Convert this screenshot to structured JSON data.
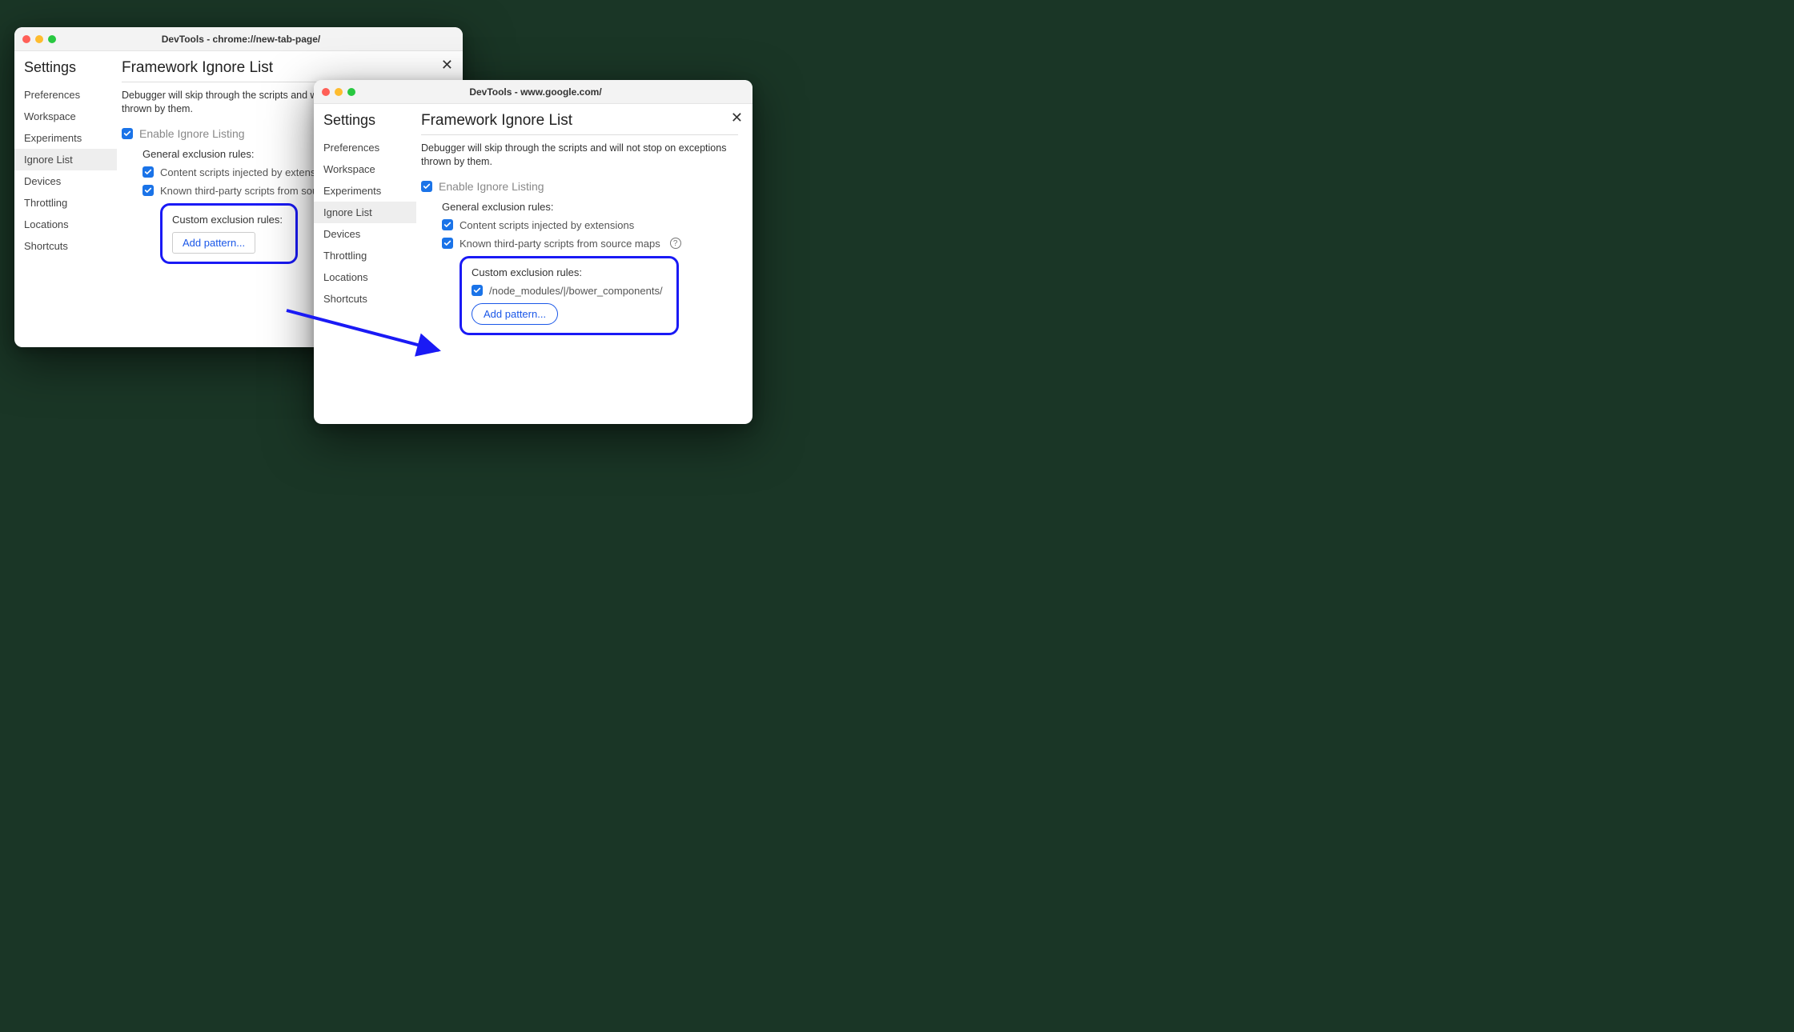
{
  "window1": {
    "title": "DevTools - chrome://new-tab-page/",
    "settings_title": "Settings",
    "sidebar": [
      "Preferences",
      "Workspace",
      "Experiments",
      "Ignore List",
      "Devices",
      "Throttling",
      "Locations",
      "Shortcuts"
    ],
    "active": "Ignore List",
    "page_title": "Framework Ignore List",
    "desc": "Debugger will skip through the scripts and will not stop on exceptions thrown by them.",
    "enable_label": "Enable Ignore Listing",
    "general_label": "General exclusion rules:",
    "rule_content": "Content scripts injected by extensions",
    "rule_thirdparty": "Known third-party scripts from source maps",
    "custom_label": "Custom exclusion rules:",
    "add_pattern": "Add pattern..."
  },
  "window2": {
    "title": "DevTools - www.google.com/",
    "settings_title": "Settings",
    "sidebar": [
      "Preferences",
      "Workspace",
      "Experiments",
      "Ignore List",
      "Devices",
      "Throttling",
      "Locations",
      "Shortcuts"
    ],
    "active": "Ignore List",
    "page_title": "Framework Ignore List",
    "desc": "Debugger will skip through the scripts and will not stop on exceptions thrown by them.",
    "enable_label": "Enable Ignore Listing",
    "general_label": "General exclusion rules:",
    "rule_content": "Content scripts injected by extensions",
    "rule_thirdparty": "Known third-party scripts from source maps",
    "custom_label": "Custom exclusion rules:",
    "custom_pattern": "/node_modules/|/bower_components/",
    "add_pattern": "Add pattern..."
  }
}
